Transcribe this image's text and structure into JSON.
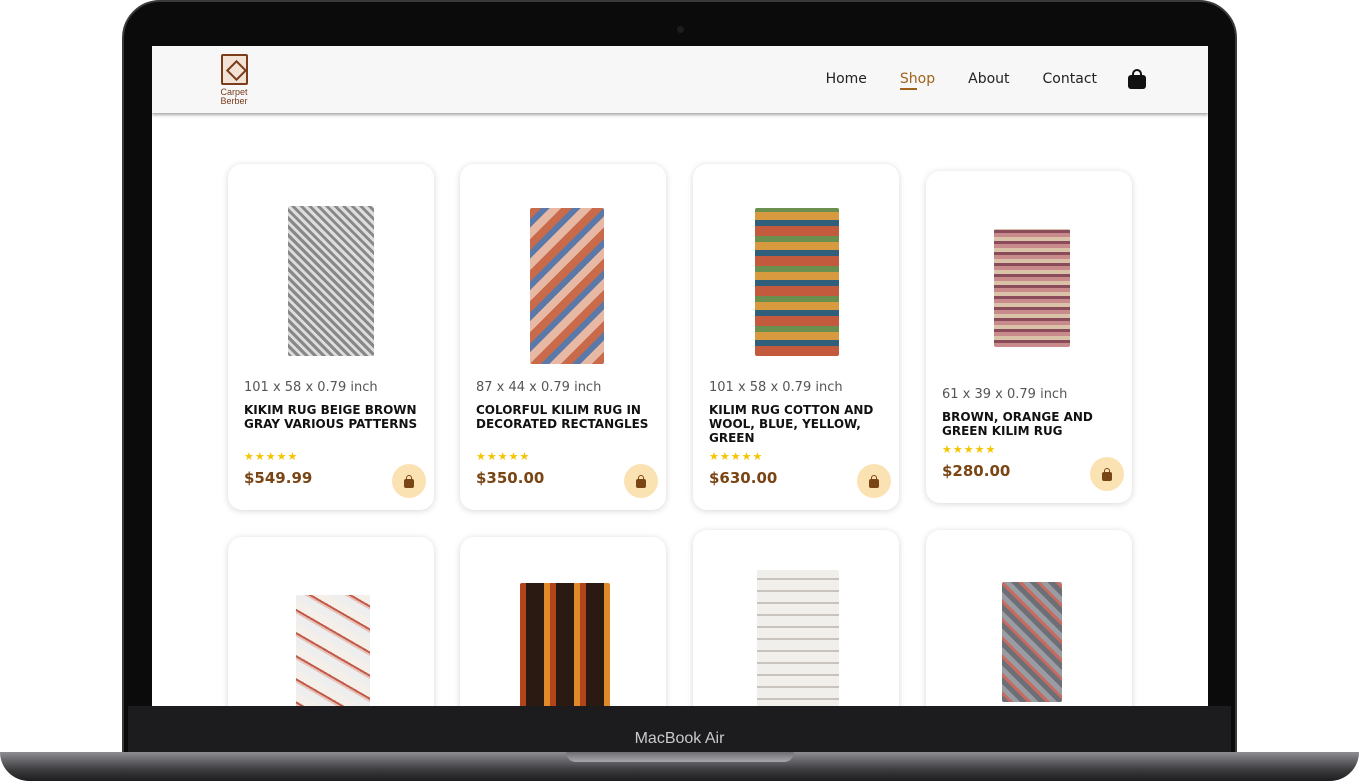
{
  "device": {
    "model_label": "MacBook Air"
  },
  "logo": {
    "line1": "Carpet",
    "line2": "Berber"
  },
  "nav": {
    "home": "Home",
    "shop": "Shop",
    "about": "About",
    "contact": "Contact"
  },
  "colors": {
    "accent": "#a0631c",
    "price": "#7a4514",
    "star": "#f5c400",
    "cart_bg": "#fbe2b3"
  },
  "products": [
    {
      "size": "101 x 58 x 0.79 inch",
      "title": "KIKIM RUG BEIGE BROWN GRAY VARIOUS PATTERNS",
      "rating": 5,
      "stars": "★★★★★",
      "price": "$549.99"
    },
    {
      "size": "87 x 44 x 0.79 inch",
      "title": "COLORFUL KILIM RUG IN DECORATED RECTANGLES",
      "rating": 5,
      "stars": "★★★★★",
      "price": "$350.00"
    },
    {
      "size": "101 x 58 x 0.79 inch",
      "title": "KILIM RUG COTTON AND WOOL, BLUE, YELLOW, GREEN",
      "rating": 5,
      "stars": "★★★★★",
      "price": "$630.00"
    },
    {
      "size": "61 x 39 x 0.79 inch",
      "title": "BROWN, ORANGE AND GREEN KILIM RUG",
      "rating": 5,
      "stars": "★★★★★",
      "price": "$280.00"
    }
  ],
  "icons": {
    "cart": "shopping-bag-icon",
    "add_to_cart": "shopping-bag-icon"
  }
}
